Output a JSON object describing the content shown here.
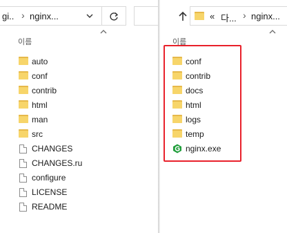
{
  "left": {
    "address": {
      "prefix": "gi..",
      "folder": "nginx..."
    },
    "column_header": "이름",
    "items": [
      {
        "label": "auto",
        "type": "folder"
      },
      {
        "label": "conf",
        "type": "folder"
      },
      {
        "label": "contrib",
        "type": "folder"
      },
      {
        "label": "html",
        "type": "folder"
      },
      {
        "label": "man",
        "type": "folder"
      },
      {
        "label": "src",
        "type": "folder"
      },
      {
        "label": "CHANGES",
        "type": "file"
      },
      {
        "label": "CHANGES.ru",
        "type": "file"
      },
      {
        "label": "configure",
        "type": "file"
      },
      {
        "label": "LICENSE",
        "type": "file"
      },
      {
        "label": "README",
        "type": "file"
      }
    ]
  },
  "right": {
    "address": {
      "overflow": "«",
      "parent": "다...",
      "folder": "nginx..."
    },
    "column_header": "이름",
    "items": [
      {
        "label": "conf",
        "type": "folder"
      },
      {
        "label": "contrib",
        "type": "folder"
      },
      {
        "label": "docs",
        "type": "folder"
      },
      {
        "label": "html",
        "type": "folder"
      },
      {
        "label": "logs",
        "type": "folder"
      },
      {
        "label": "temp",
        "type": "folder"
      },
      {
        "label": "nginx.exe",
        "type": "exe"
      }
    ]
  },
  "colors": {
    "highlight": "#e8202a",
    "folder": "#f7d56a",
    "exe_icon": "#1f9d3a"
  }
}
